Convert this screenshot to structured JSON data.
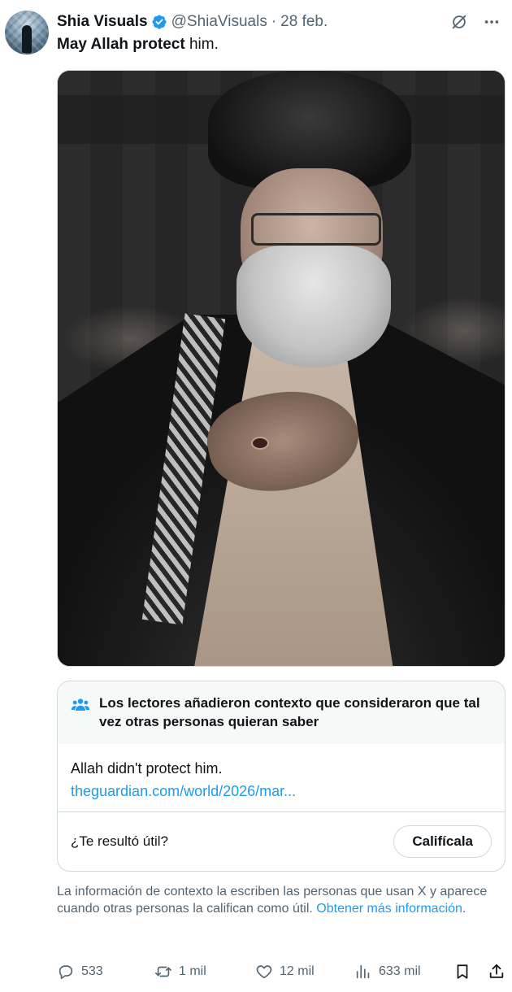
{
  "tweet": {
    "author_name": "Shia Visuals",
    "handle": "@ShiaVisuals",
    "separator": "·",
    "date": "28 feb.",
    "text_bold": "May Allah protect",
    "text_rest": " him."
  },
  "community_note": {
    "title": "Los lectores añadieron contexto que consideraron que tal vez otras personas quieran saber",
    "text": "Allah didn't protect him.",
    "link": "theguardian.com/world/2026/mar...",
    "question": "¿Te resultó útil?",
    "rate_button": "Califícala"
  },
  "disclaimer": {
    "text": "La información de contexto la escriben las personas que usan X y aparece cuando otras personas la califican como útil. ",
    "link": "Obtener más información",
    "suffix": "."
  },
  "actions": {
    "replies": "533",
    "reposts": "1 mil",
    "likes": "12 mil",
    "views": "633 mil"
  },
  "colors": {
    "accent": "#1d9bf0",
    "secondary_text": "#536471",
    "border": "#cfd9de"
  },
  "icons": [
    "verified-badge-icon",
    "grok-icon",
    "more-icon",
    "people-icon",
    "reply-icon",
    "repost-icon",
    "like-icon",
    "views-icon",
    "bookmark-icon",
    "share-icon"
  ]
}
